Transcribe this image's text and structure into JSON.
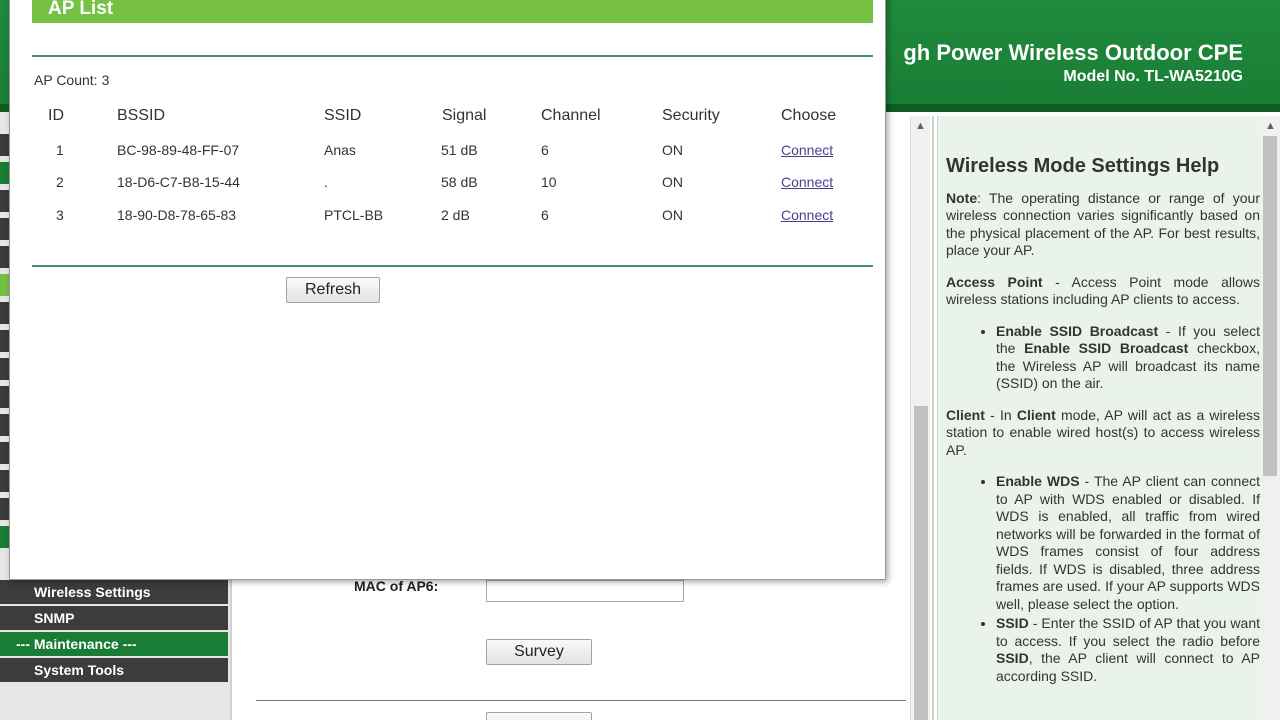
{
  "header": {
    "title": "gh Power Wireless Outdoor CPE",
    "model": "Model No. TL-WA5210G"
  },
  "menu": {
    "items": [
      {
        "label": "Wireless Settings",
        "group": false
      },
      {
        "label": "SNMP",
        "group": false
      },
      {
        "label": "--- Maintenance ---",
        "group": true
      },
      {
        "label": "System Tools",
        "group": false
      }
    ]
  },
  "main": {
    "mac_label": "MAC of AP6:",
    "mac_value": "",
    "survey_label": "Survey"
  },
  "popup": {
    "title": "AP List",
    "ap_count_label": "AP Count:",
    "ap_count": "3",
    "columns": [
      "ID",
      "BSSID",
      "SSID",
      "Signal",
      "Channel",
      "Security",
      "Choose"
    ],
    "rows": [
      {
        "id": "1",
        "bssid": "BC-98-89-48-FF-07",
        "ssid": "Anas",
        "signal": "51 dB",
        "channel": "6",
        "security": "ON",
        "choose": "Connect"
      },
      {
        "id": "2",
        "bssid": "18-D6-C7-B8-15-44",
        "ssid": ".",
        "signal": "58 dB",
        "channel": "10",
        "security": "ON",
        "choose": "Connect"
      },
      {
        "id": "3",
        "bssid": "18-90-D8-78-65-83",
        "ssid": "PTCL-BB",
        "signal": "2 dB",
        "channel": "6",
        "security": "ON",
        "choose": "Connect"
      }
    ],
    "refresh_label": "Refresh"
  },
  "help": {
    "title": "Wireless Mode Settings Help",
    "note_label": "Note",
    "note_text": ": The operating distance or range of your wireless connection varies significantly based on the physical placement of the AP. For best results, place your AP.",
    "ap_label": "Access Point",
    "ap_text": " - Access Point mode allows wireless stations including AP clients to access.",
    "ssid_broadcast_label": "Enable SSID Broadcast",
    "ssid_broadcast_text1": " - If you select the ",
    "ssid_broadcast_label2": "Enable SSID Broadcast",
    "ssid_broadcast_text2": " checkbox, the Wireless AP will broadcast its name (SSID) on the air.",
    "client_label": "Client",
    "client_text1": " - In ",
    "client_label2": "Client",
    "client_text2": " mode, AP will act as a wireless station to enable wired host(s) to access wireless AP.",
    "wds_label": "Enable WDS",
    "wds_text": " - The AP client can connect to AP with WDS enabled or disabled. If WDS is enabled, all traffic from wired networks will be forwarded in the format of WDS frames consist of four address fields. If WDS is disabled, three address frames are used. If your AP supports WDS well, please select the option.",
    "ssid_label": "SSID",
    "ssid_text1": " - Enter the SSID of AP that you want to access. If you select the radio before ",
    "ssid_label2": "SSID",
    "ssid_text2": ", the AP client will connect to AP according SSID."
  }
}
